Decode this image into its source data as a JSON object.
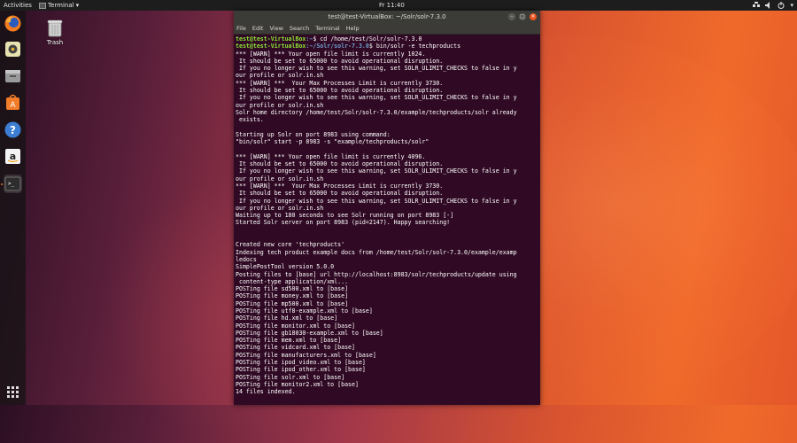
{
  "topbar": {
    "activities": "Activities",
    "app_name": "Terminal",
    "clock": "Fr 11:40"
  },
  "desktop": {
    "trash_label": "Trash"
  },
  "terminal": {
    "title": "test@test-VirtualBox: ~/Solr/solr-7.3.0",
    "menu": [
      "File",
      "Edit",
      "View",
      "Search",
      "Terminal",
      "Help"
    ],
    "prompts": [
      {
        "user": "test@test-VirtualBox",
        "path": ":~",
        "cmd": "$ cd /home/test/Solr/solr-7.3.0"
      },
      {
        "user": "test@test-VirtualBox",
        "path": ":~/Solr/solr-7.3.0",
        "cmd": "$ bin/solr -e techproducts"
      }
    ],
    "lines": [
      "*** [WARN] *** Your open file limit is currently 1024.",
      " It should be set to 65000 to avoid operational disruption.",
      " If you no longer wish to see this warning, set SOLR_ULIMIT_CHECKS to false in y",
      "our profile or solr.in.sh",
      "*** [WARN] ***  Your Max Processes Limit is currently 3730.",
      " It should be set to 65000 to avoid operational disruption.",
      " If you no longer wish to see this warning, set SOLR_ULIMIT_CHECKS to false in y",
      "our profile or solr.in.sh",
      "Solr home directory /home/test/Solr/solr-7.3.0/example/techproducts/solr already",
      " exists.",
      "",
      "Starting up Solr on port 8983 using command:",
      "\"bin/solr\" start -p 8983 -s \"example/techproducts/solr\"",
      "",
      "*** [WARN] *** Your open file limit is currently 4096.",
      " It should be set to 65000 to avoid operational disruption.",
      " If you no longer wish to see this warning, set SOLR_ULIMIT_CHECKS to false in y",
      "our profile or solr.in.sh",
      "*** [WARN] ***  Your Max Processes Limit is currently 3730.",
      " It should be set to 65000 to avoid operational disruption.",
      " If you no longer wish to see this warning, set SOLR_ULIMIT_CHECKS to false in y",
      "our profile or solr.in.sh",
      "Waiting up to 180 seconds to see Solr running on port 8983 [-]",
      "Started Solr server on port 8983 (pid=2147). Happy searching!",
      "",
      "",
      "Created new core 'techproducts'",
      "Indexing tech product example docs from /home/test/Solr/solr-7.3.0/example/examp",
      "ledocs",
      "SimplePostTool version 5.0.0",
      "Posting files to [base] url http://localhost:8983/solr/techproducts/update using",
      " content-type application/xml...",
      "POSTing file sd500.xml to [base]",
      "POSTing file money.xml to [base]",
      "POSTing file mp500.xml to [base]",
      "POSTing file utf8-example.xml to [base]",
      "POSTing file hd.xml to [base]",
      "POSTing file monitor.xml to [base]",
      "POSTing file gb18030-example.xml to [base]",
      "POSTing file mem.xml to [base]",
      "POSTing file vidcard.xml to [base]",
      "POSTing file manufacturers.xml to [base]",
      "POSTing file ipod_video.xml to [base]",
      "POSTing file ipod_other.xml to [base]",
      "POSTing file solr.xml to [base]",
      "POSTing file monitor2.xml to [base]",
      "14 files indexed."
    ]
  },
  "dock": {
    "items": [
      "firefox-icon",
      "rhythmbox-icon",
      "files-icon",
      "software-icon",
      "help-icon",
      "amazon-icon",
      "terminal-icon"
    ],
    "apps_grid": "show-applications-icon"
  },
  "colors": {
    "terminal_bg": "#300a24",
    "prompt_user": "#8ae234",
    "prompt_path": "#729fcf",
    "accent": "#e95420"
  }
}
